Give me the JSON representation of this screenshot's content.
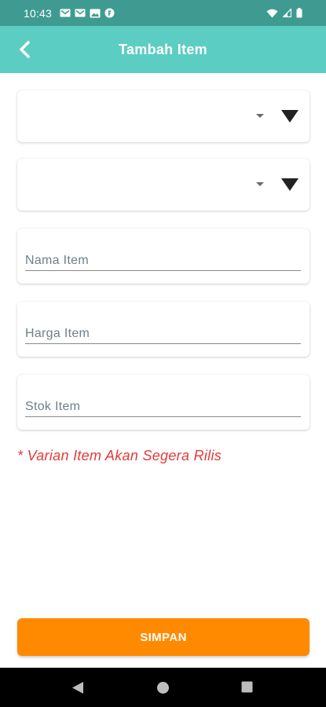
{
  "status_bar": {
    "time": "10:43",
    "left_icons": [
      "gmail-icon",
      "gmail-icon",
      "photos-icon",
      "app-notification-icon"
    ],
    "right_icons": [
      "wifi-icon",
      "signal-icon",
      "battery-icon"
    ]
  },
  "app_bar": {
    "title": "Tambah Item",
    "back_icon": "chevron-left-icon",
    "color": "#5ccdc2"
  },
  "form": {
    "dropdown_1": {
      "value": ""
    },
    "dropdown_2": {
      "value": ""
    },
    "name": {
      "value": "",
      "placeholder": "Nama Item"
    },
    "price": {
      "value": "",
      "placeholder": "Harga Item"
    },
    "stock": {
      "value": "",
      "placeholder": "Stok Item"
    }
  },
  "notice": "* Varian Item Akan Segera Rilis",
  "save_button": {
    "label": "SIMPAN",
    "color": "#ff8a00"
  },
  "nav_bar": {
    "icons": [
      "back-triangle-icon",
      "home-circle-icon",
      "recents-square-icon"
    ]
  }
}
